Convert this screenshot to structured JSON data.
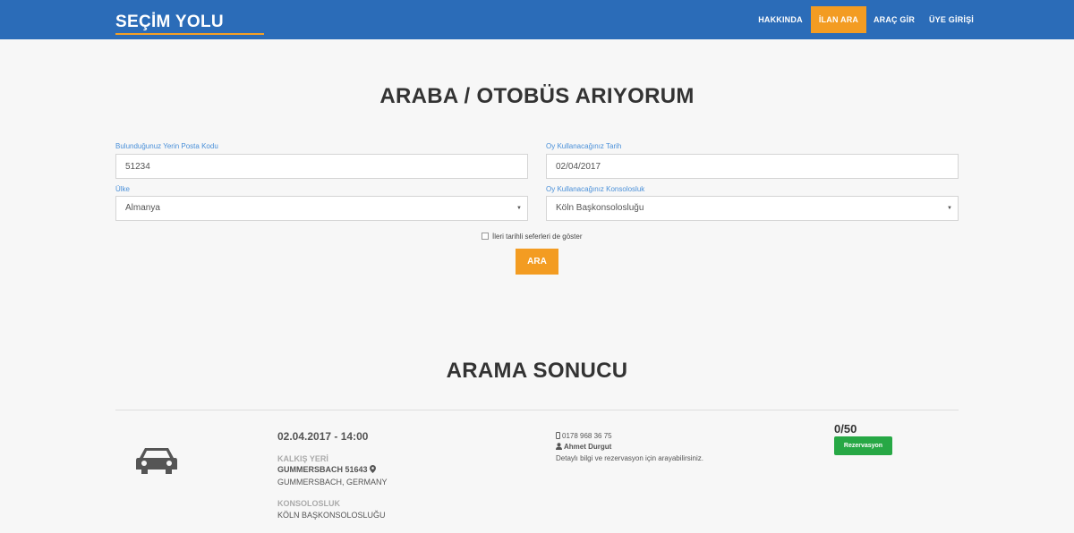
{
  "brand": {
    "name": "SEÇİM YOLU"
  },
  "nav": {
    "items": [
      "HAKKINDA",
      "İLAN ARA",
      "ARAÇ GİR",
      "ÜYE GİRİŞİ"
    ],
    "active_index": 1
  },
  "search": {
    "title": "ARABA / OTOBÜS ARIYORUM",
    "postal_label": "Bulunduğunuz Yerin Posta Kodu",
    "postal_value": "51234",
    "date_label": "Oy Kullanacağınız Tarih",
    "date_value": "02/04/2017",
    "country_label": "Ülke",
    "country_value": "Almanya",
    "consulate_label": "Oy Kullanacağınız Konsolosluk",
    "consulate_value": "Köln Başkonsolosluğu",
    "checkbox_label": "İleri tarihli seferleri de göster",
    "button_label": "ARA"
  },
  "results": {
    "title": "ARAMA SONUCU",
    "items": [
      {
        "datetime": "02.04.2017 - 14:00",
        "departure_heading": "KALKIŞ YERİ",
        "departure_city": "GUMMERSBACH 51643",
        "departure_country": "GUMMERSBACH, GERMANY",
        "consulate_heading": "KONSOLOSLUK",
        "consulate_name": "KÖLN BAŞKONSOLOSLUĞU",
        "phone": "0178 968 36 75",
        "contact_name": "Ahmet Durgut",
        "info": "Detaylı bilgi ve rezervasyon için arayabilirsiniz.",
        "seats": "0/50",
        "reserve_label": "Rezervasyon"
      }
    ]
  },
  "colors": {
    "primary": "#2b6cb8",
    "accent": "#f39c22",
    "success": "#27a845"
  },
  "icons": [
    "car-icon",
    "map-marker-icon",
    "phone-icon",
    "user-icon",
    "caret-down-icon"
  ]
}
